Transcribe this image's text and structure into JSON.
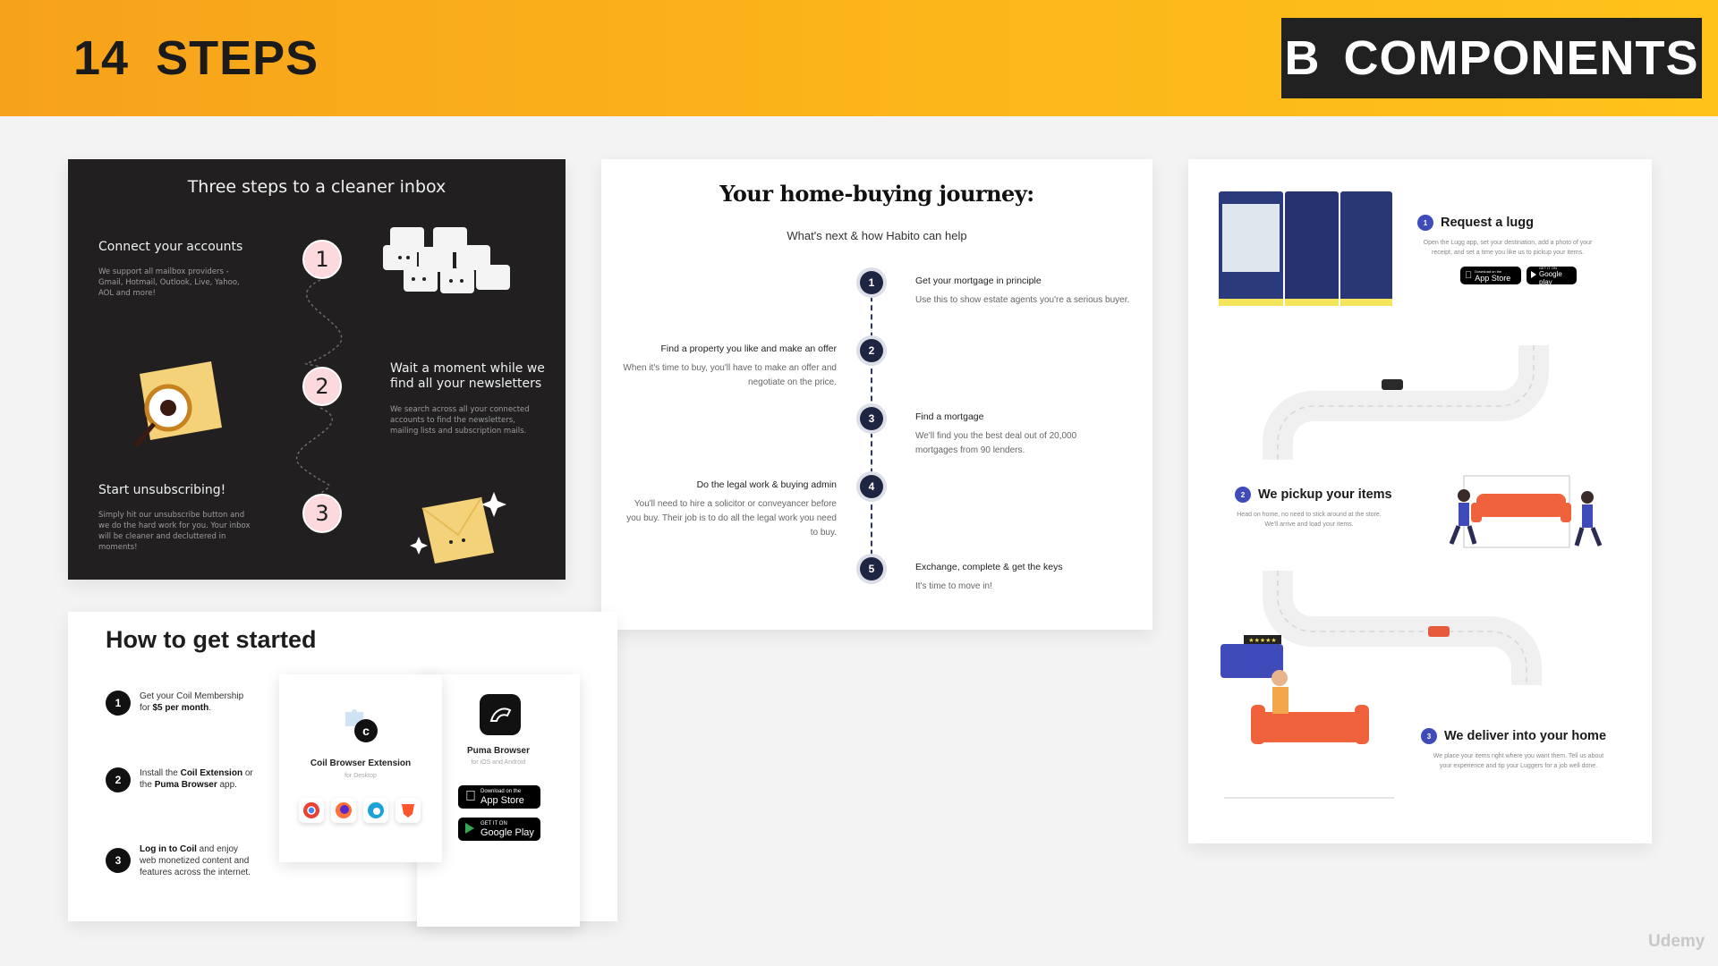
{
  "header": {
    "number": "14",
    "title": "STEPS",
    "section_letter": "B",
    "section_title": "COMPONENTS"
  },
  "inbox": {
    "title": "Three steps to a cleaner inbox",
    "steps": [
      {
        "num": "1",
        "title": "Connect your accounts",
        "desc": "We support all mailbox providers - Gmail, Hotmail, Outlook, Live, Yahoo, AOL and more!"
      },
      {
        "num": "2",
        "title": "Wait a moment while we find all your newsletters",
        "desc": "We search across all your connected accounts to find the newsletters, mailing lists and subscription mails."
      },
      {
        "num": "3",
        "title": "Start unsubscribing!",
        "desc": "Simply hit our unsubscribe button and we do the hard work for you. Your inbox will be cleaner and decluttered in moments!"
      }
    ]
  },
  "journey": {
    "title": "Your home-buying journey:",
    "subtitle": "What's next & how Habito can help",
    "steps": [
      {
        "num": "1",
        "title": "Get your mortgage in principle",
        "desc": "Use this to show estate agents you're a serious buyer."
      },
      {
        "num": "2",
        "title": "Find a property you like and make an offer",
        "desc": "When it's time to buy, you'll have to make an offer and negotiate on the price."
      },
      {
        "num": "3",
        "title": "Find a mortgage",
        "desc": "We'll find you the best deal out of 20,000 mortgages from 90 lenders."
      },
      {
        "num": "4",
        "title": "Do the legal work & buying admin",
        "desc": "You'll need to hire a solicitor or conveyancer before you buy. Their job is to do all the legal work you need to buy."
      },
      {
        "num": "5",
        "title": "Exchange, complete & get the keys",
        "desc": "It's time to move in!"
      }
    ]
  },
  "coil": {
    "title": "How to get started",
    "steps": [
      {
        "num": "1",
        "pre": "Get your Coil Membership",
        "line2_pre": "for ",
        "bold": "$5 per month",
        "post": "."
      },
      {
        "num": "2",
        "pre": "Install the ",
        "bold1": "Coil Extension",
        "mid": " or",
        "line2_pre": "the ",
        "bold2": "Puma Browser",
        "post": " app."
      },
      {
        "num": "3",
        "bold": "Log in to Coil",
        "post1": " and enjoy",
        "line2": "web monetized content and",
        "line3": "features across the internet."
      }
    ],
    "extension": {
      "name": "Coil Browser Extension",
      "sub": "for Desktop"
    },
    "puma": {
      "name": "Puma Browser",
      "sub": "for iOS and Android"
    },
    "appstore": {
      "small": "Download on the",
      "big": "App Store"
    },
    "googleplay": {
      "small": "GET IT ON",
      "big": "Google Play"
    }
  },
  "lugg": {
    "steps": [
      {
        "num": "1",
        "title": "Request a lugg",
        "desc1": "Open the Lugg app, set your destination, add a photo of your",
        "desc2": "receipt, and set a time you like us to pickup your items."
      },
      {
        "num": "2",
        "title": "We pickup your items",
        "desc1": "Head on home, no need to stick around at the store.",
        "desc2": "We'll arrive and load your items."
      },
      {
        "num": "3",
        "title": "We deliver into your home",
        "desc1": "We place your items right where you want them. Tell us about",
        "desc2": "your experience and tip your Luggers for a job well done."
      }
    ],
    "appstore": {
      "small": "Download on the",
      "big": "App Store"
    },
    "googleplay": {
      "small": "GET IT ON",
      "big": "Google play"
    },
    "review_stars": "★★★★★"
  },
  "watermark": "Udemy",
  "colors": {
    "accent_orange": "#f7a21b",
    "accent_yellow": "#ffc21a",
    "dark_card": "#211f1f",
    "pink_circle": "#fbd9dc",
    "navy": "#1d2542",
    "lugg_blue": "#3e4bb8",
    "sofa": "#f0623c"
  }
}
